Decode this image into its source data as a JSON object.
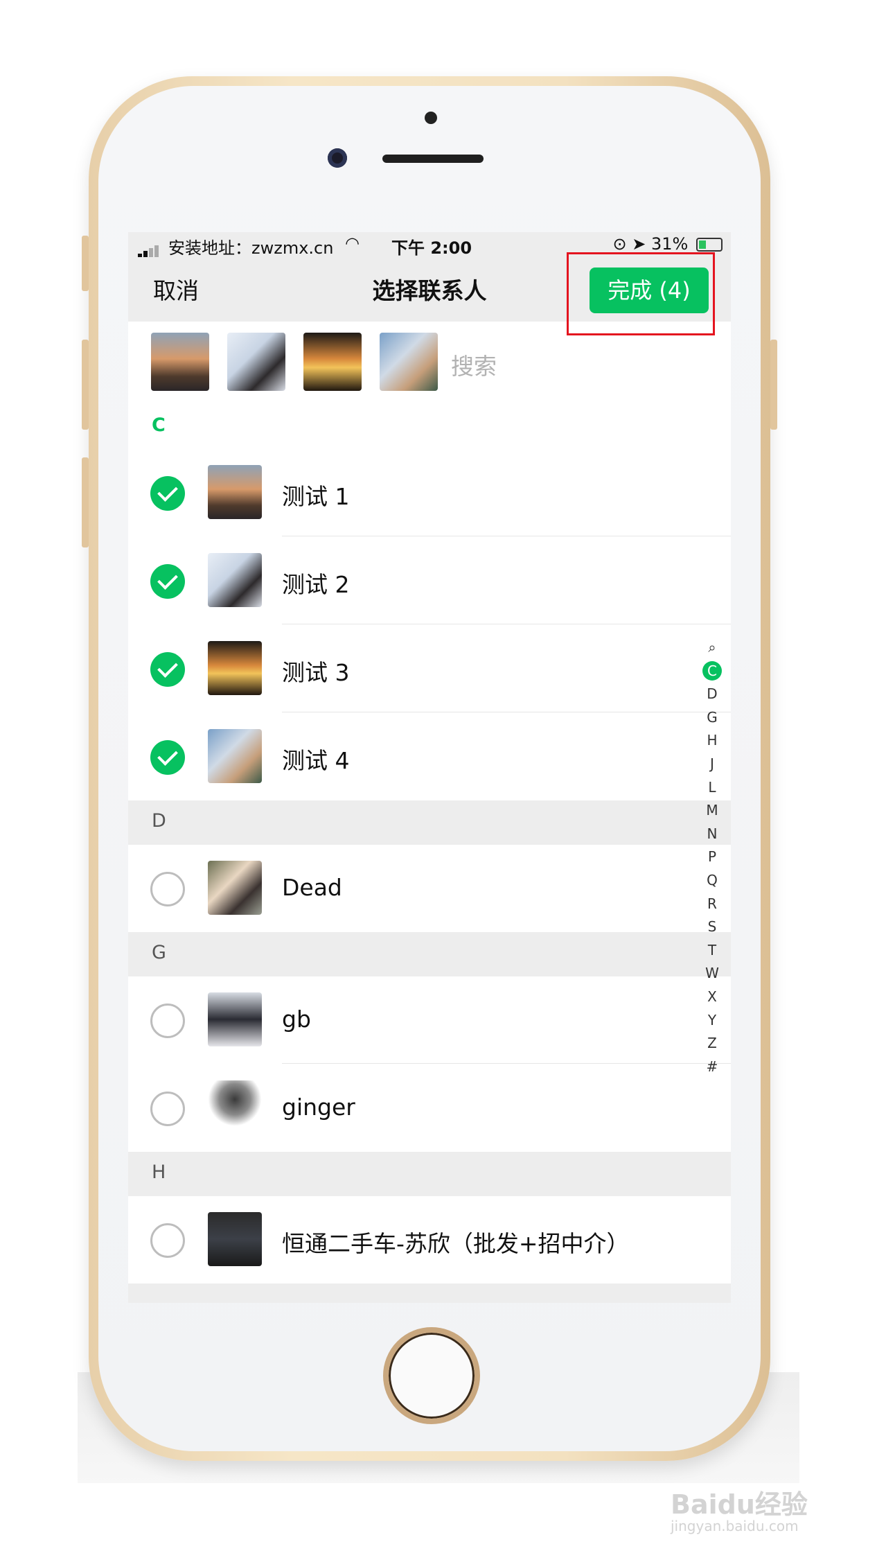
{
  "status_bar": {
    "carrier": "安装地址：zwzmx.cn",
    "time": "下午 2:00",
    "battery": "31%"
  },
  "nav": {
    "cancel": "取消",
    "title": "选择联系人",
    "done": "完成 (4)"
  },
  "search": {
    "placeholder": "搜索"
  },
  "sections": [
    {
      "letter": "C",
      "contacts": [
        {
          "name": "测试 1",
          "checked": true
        },
        {
          "name": "测试 2",
          "checked": true
        },
        {
          "name": "测试 3",
          "checked": true
        },
        {
          "name": "测试 4",
          "checked": true
        }
      ]
    },
    {
      "letter": "D",
      "contacts": [
        {
          "name": "Dead",
          "checked": false
        }
      ]
    },
    {
      "letter": "G",
      "contacts": [
        {
          "name": "gb",
          "checked": false
        },
        {
          "name": "ginger",
          "checked": false
        }
      ]
    },
    {
      "letter": "H",
      "contacts": [
        {
          "name": "恒通二手车-苏欣（批发+招中介）",
          "checked": false
        }
      ]
    }
  ],
  "index_letters": [
    "C",
    "D",
    "G",
    "H",
    "J",
    "L",
    "M",
    "N",
    "P",
    "Q",
    "R",
    "S",
    "T",
    "W",
    "X",
    "Y",
    "Z",
    "#"
  ],
  "index_active": "C",
  "watermark": {
    "brand": "Baidu经验",
    "url": "jingyan.baidu.com"
  },
  "colors": {
    "accent": "#07c160",
    "highlight": "#e4141f"
  }
}
